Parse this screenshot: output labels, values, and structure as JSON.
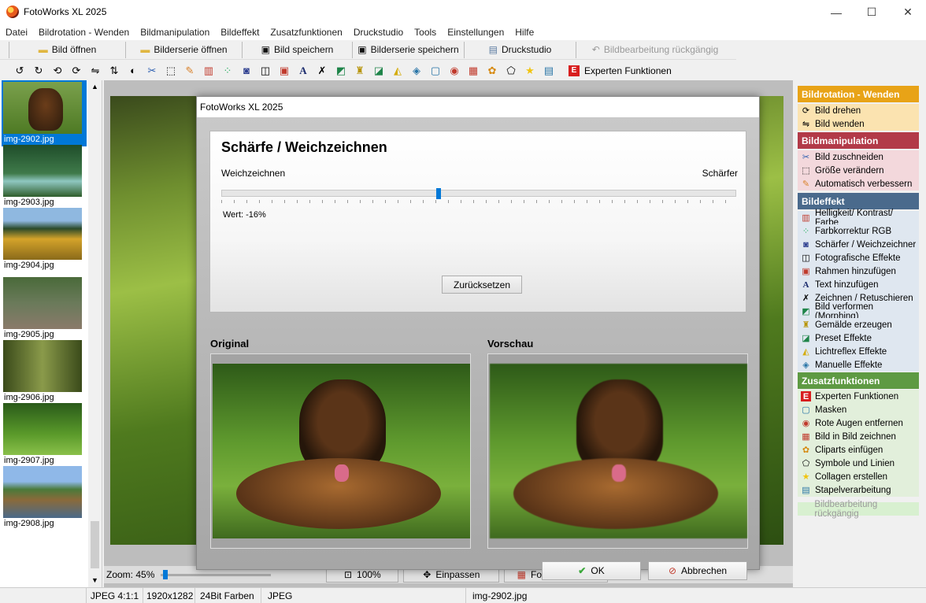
{
  "window": {
    "title": "FotoWorks XL 2025",
    "minimize": "—",
    "maximize": "☐",
    "close": "✕"
  },
  "menu": [
    "Datei",
    "Bildrotation - Wenden",
    "Bildmanipulation",
    "Bildeffekt",
    "Zusatzfunktionen",
    "Druckstudio",
    "Tools",
    "Einstellungen",
    "Hilfe"
  ],
  "toolbar1": {
    "open": "Bild öffnen",
    "open_series": "Bilderserie öffnen",
    "save": "Bild speichern",
    "save_series": "Bilderserie speichern",
    "print": "Druckstudio",
    "undo": "Bildbearbeitung rückgängig"
  },
  "toolbar2": {
    "experts": "Experten Funktionen"
  },
  "thumbnails": [
    {
      "name": "img-2902.jpg",
      "selected": true
    },
    {
      "name": "img-2903.jpg"
    },
    {
      "name": "img-2904.jpg"
    },
    {
      "name": "img-2905.jpg"
    },
    {
      "name": "img-2906.jpg"
    },
    {
      "name": "img-2907.jpg"
    },
    {
      "name": "img-2908.jpg"
    }
  ],
  "zoom": {
    "label": "Zoom: 45%",
    "btn_100": "100%",
    "btn_fit": "Einpassen",
    "btn_manager": "Fotoverwaltung"
  },
  "side": {
    "rot_header": "Bildrotation - Wenden",
    "rot_items": [
      "Bild drehen",
      "Bild wenden"
    ],
    "manip_header": "Bildmanipulation",
    "manip_items": [
      "Bild zuschneiden",
      "Größe verändern",
      "Automatisch verbessern"
    ],
    "effect_header": "Bildeffekt",
    "effect_items": [
      "Helligkeit/ Kontrast/ Farbe",
      "Farbkorrektur RGB",
      "Schärfer / Weichzeichner",
      "Fotografische Effekte",
      "Rahmen hinzufügen",
      "Text hinzufügen",
      "Zeichnen / Retuschieren",
      "Bild verformen (Morphing)",
      "Gemälde erzeugen",
      "Preset Effekte",
      "Lichtreflex Effekte",
      "Manuelle Effekte"
    ],
    "extra_header": "Zusatzfunktionen",
    "extra_items": [
      "Experten Funktionen",
      "Masken",
      "Rote Augen entfernen",
      "Bild in Bild zeichnen",
      "Cliparts einfügen",
      "Symbole und Linien",
      "Collagen erstellen",
      "Stapelverarbeitung"
    ],
    "undo": "Bildbearbeitung rückgängig",
    "colors": {
      "rot": "#e8a317",
      "manip": "#b23a48",
      "effect": "#4a6a8c",
      "extra": "#5e9a43"
    }
  },
  "status": {
    "format": "JPEG  4:1:1",
    "size": "1920x1282",
    "depth": "24Bit Farben",
    "type": "JPEG",
    "file": "img-2902.jpg"
  },
  "dialog": {
    "title": "FotoWorks XL 2025",
    "heading": "Schärfe / Weichzeichnen",
    "left_label": "Weichzeichnen",
    "right_label": "Schärfer",
    "value_label": "Wert: -16%",
    "value": -16,
    "reset": "Zurücksetzen",
    "original_label": "Original",
    "preview_label": "Vorschau",
    "ok": "OK",
    "cancel": "Abbrechen"
  }
}
